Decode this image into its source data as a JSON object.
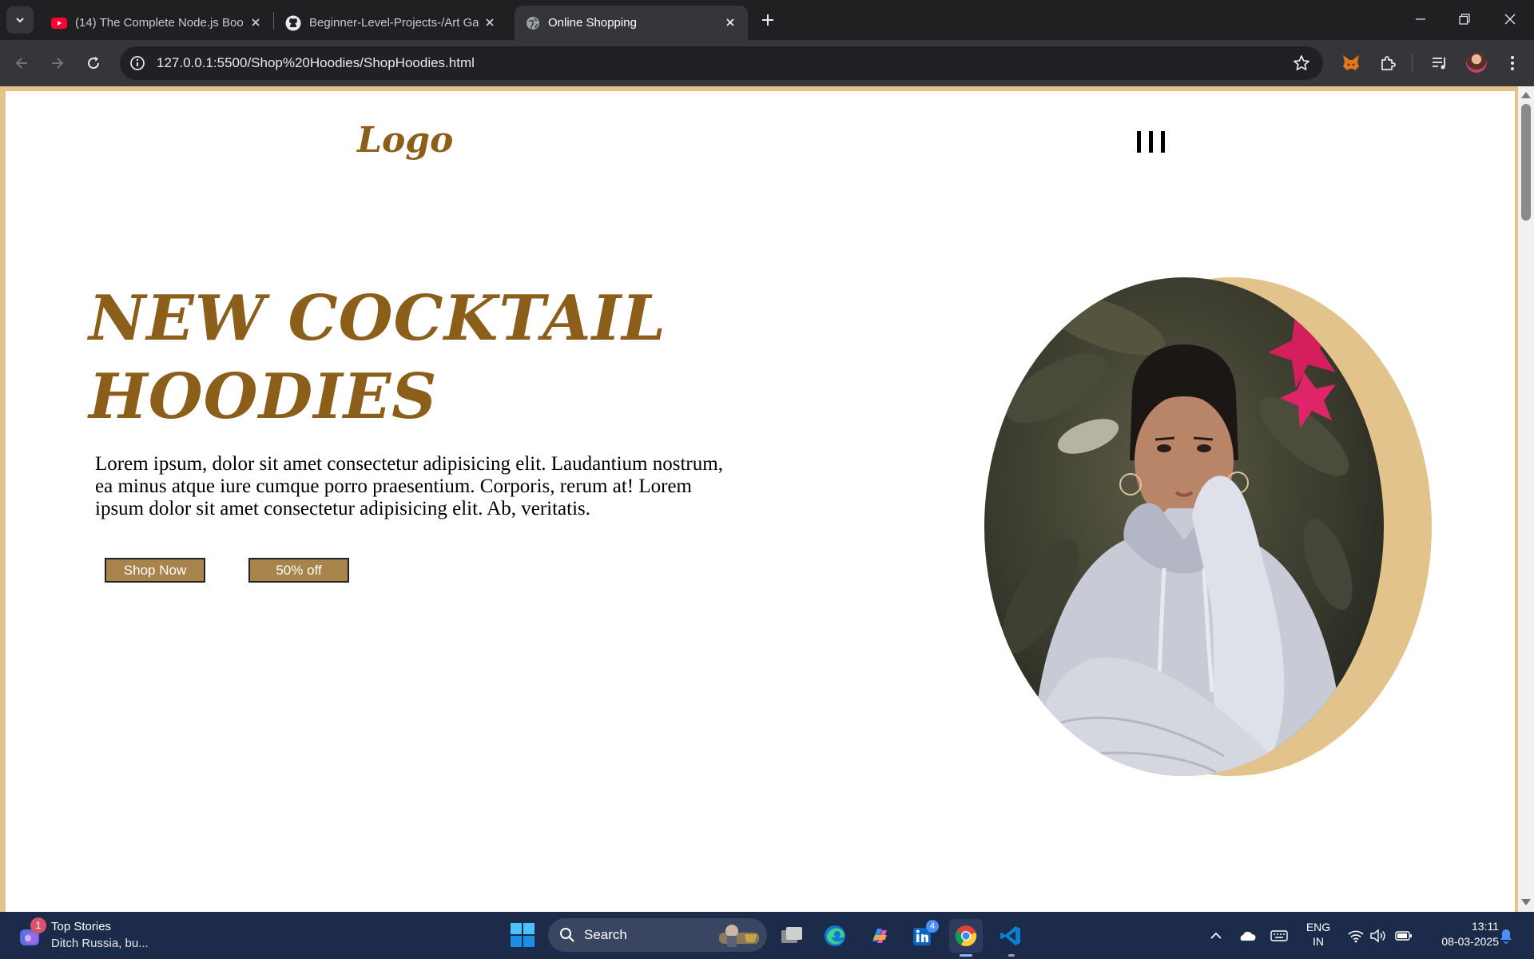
{
  "browser": {
    "tabs": [
      {
        "title": "(14) The Complete Node.js Boo",
        "icon": "youtube-icon",
        "active": false
      },
      {
        "title": "Beginner-Level-Projects-/Art Ga",
        "icon": "github-icon",
        "active": false
      },
      {
        "title": "Online Shopping",
        "icon": "globe-icon",
        "active": true
      }
    ],
    "url": "127.0.0.1:5500/Shop%20Hoodies/ShopHoodies.html"
  },
  "page": {
    "logo": "Logo",
    "hero": {
      "title_line1": "NEW COCKTAIL",
      "title_line2": "HOODIES",
      "description": "Lorem ipsum, dolor sit amet consectetur adipisicing elit. Laudantium nostrum, ea minus atque iure cumque porro praesentium. Corporis, rerum at! Lorem ipsum dolor sit amet consectetur adipisicing elit. Ab, veritatis.",
      "primary_button": "Shop Now",
      "secondary_button": "50% off"
    },
    "colors": {
      "accent": "#8b5e1a",
      "button": "#a8844c",
      "frame": "#e3c38c"
    }
  },
  "taskbar": {
    "widget": {
      "badge": "1",
      "title": "Top Stories",
      "subtitle": "Ditch Russia, bu..."
    },
    "search_label": "Search",
    "linkedin_badge": "4",
    "language": {
      "line1": "ENG",
      "line2": "IN"
    },
    "clock": {
      "time": "13:11",
      "date": "08-03-2025"
    }
  }
}
